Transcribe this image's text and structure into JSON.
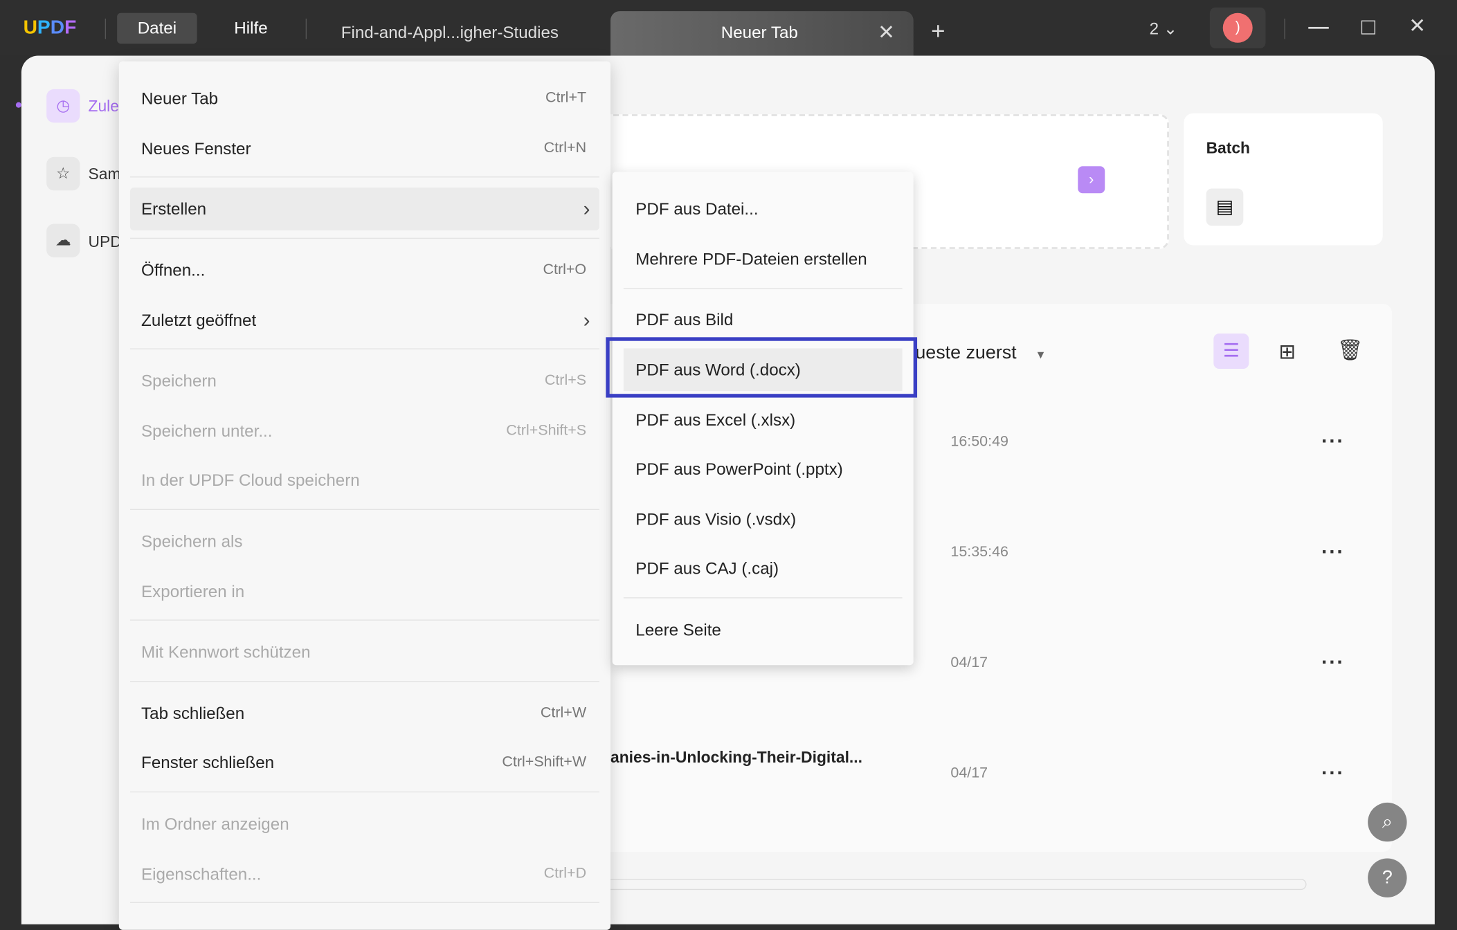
{
  "app": {
    "logo": "UPDF",
    "menu": [
      "Datei",
      "Hilfe"
    ],
    "tabs": [
      {
        "label": "Find-and-Appl...igher-Studies"
      },
      {
        "label": "Neuer Tab"
      }
    ],
    "window_count": "2",
    "avatar_text": ")"
  },
  "sidebar": {
    "items": [
      {
        "label": "Zule",
        "icon": "clock-icon"
      },
      {
        "label": "Sam",
        "icon": "star-icon"
      },
      {
        "label": "UPD",
        "icon": "cloud-icon"
      }
    ]
  },
  "main": {
    "batch_title": "Batch",
    "sort_label": "ueste zuerst",
    "files": [
      {
        "name": "",
        "time": "16:50:49"
      },
      {
        "name": "",
        "time": "15:35:46"
      },
      {
        "name": "",
        "time": "04/17"
      },
      {
        "name": "anies-in-Unlocking-Their-Digital...",
        "time": "04/17"
      }
    ]
  },
  "file_menu": {
    "items": [
      {
        "label": "Neuer Tab",
        "shortcut": "Ctrl+T"
      },
      {
        "label": "Neues Fenster",
        "shortcut": "Ctrl+N"
      },
      {
        "label": "Erstellen",
        "shortcut": ""
      },
      {
        "label": "Öffnen...",
        "shortcut": "Ctrl+O"
      },
      {
        "label": "Zuletzt geöffnet",
        "shortcut": ""
      },
      {
        "label": "Speichern",
        "shortcut": "Ctrl+S"
      },
      {
        "label": "Speichern unter...",
        "shortcut": "Ctrl+Shift+S"
      },
      {
        "label": "In der UPDF Cloud speichern",
        "shortcut": ""
      },
      {
        "label": "Speichern als",
        "shortcut": ""
      },
      {
        "label": "Exportieren in",
        "shortcut": ""
      },
      {
        "label": "Mit Kennwort schützen",
        "shortcut": ""
      },
      {
        "label": "Tab schließen",
        "shortcut": "Ctrl+W"
      },
      {
        "label": "Fenster schließen",
        "shortcut": "Ctrl+Shift+W"
      },
      {
        "label": "Im Ordner anzeigen",
        "shortcut": ""
      },
      {
        "label": "Eigenschaften...",
        "shortcut": "Ctrl+D"
      }
    ]
  },
  "create_submenu": {
    "items": [
      "PDF aus Datei...",
      "Mehrere PDF-Dateien erstellen",
      "PDF aus Bild",
      "PDF aus Word (.docx)",
      "PDF aus Excel (.xlsx)",
      "PDF aus PowerPoint (.pptx)",
      "PDF aus Visio (.vsdx)",
      "PDF aus CAJ (.caj)",
      "Leere Seite"
    ],
    "highlighted": "PDF aus Word (.docx)"
  },
  "colors": {
    "accent": "#a56df0",
    "highlight_box": "#3a3fc4",
    "avatar": "#f07070"
  }
}
